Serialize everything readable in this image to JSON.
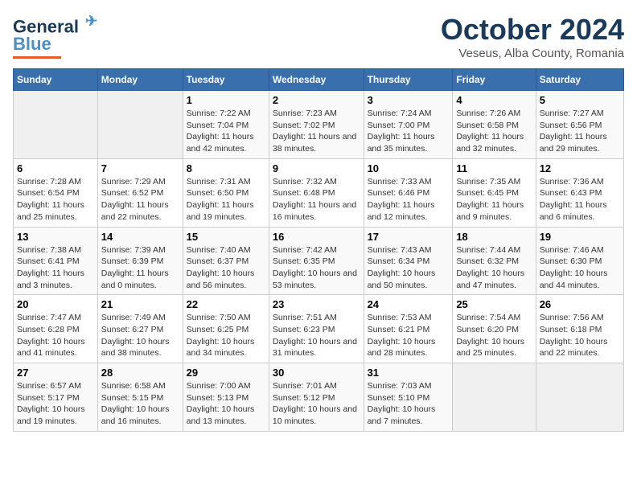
{
  "header": {
    "logo_line1": "General",
    "logo_line2": "Blue",
    "month_title": "October 2024",
    "location": "Veseus, Alba County, Romania"
  },
  "weekdays": [
    "Sunday",
    "Monday",
    "Tuesday",
    "Wednesday",
    "Thursday",
    "Friday",
    "Saturday"
  ],
  "weeks": [
    [
      {
        "day": "",
        "empty": true
      },
      {
        "day": "",
        "empty": true
      },
      {
        "day": "1",
        "sunrise": "7:22 AM",
        "sunset": "7:04 PM",
        "daylight": "11 hours and 42 minutes."
      },
      {
        "day": "2",
        "sunrise": "7:23 AM",
        "sunset": "7:02 PM",
        "daylight": "11 hours and 38 minutes."
      },
      {
        "day": "3",
        "sunrise": "7:24 AM",
        "sunset": "7:00 PM",
        "daylight": "11 hours and 35 minutes."
      },
      {
        "day": "4",
        "sunrise": "7:26 AM",
        "sunset": "6:58 PM",
        "daylight": "11 hours and 32 minutes."
      },
      {
        "day": "5",
        "sunrise": "7:27 AM",
        "sunset": "6:56 PM",
        "daylight": "11 hours and 29 minutes."
      }
    ],
    [
      {
        "day": "6",
        "sunrise": "7:28 AM",
        "sunset": "6:54 PM",
        "daylight": "11 hours and 25 minutes."
      },
      {
        "day": "7",
        "sunrise": "7:29 AM",
        "sunset": "6:52 PM",
        "daylight": "11 hours and 22 minutes."
      },
      {
        "day": "8",
        "sunrise": "7:31 AM",
        "sunset": "6:50 PM",
        "daylight": "11 hours and 19 minutes."
      },
      {
        "day": "9",
        "sunrise": "7:32 AM",
        "sunset": "6:48 PM",
        "daylight": "11 hours and 16 minutes."
      },
      {
        "day": "10",
        "sunrise": "7:33 AM",
        "sunset": "6:46 PM",
        "daylight": "11 hours and 12 minutes."
      },
      {
        "day": "11",
        "sunrise": "7:35 AM",
        "sunset": "6:45 PM",
        "daylight": "11 hours and 9 minutes."
      },
      {
        "day": "12",
        "sunrise": "7:36 AM",
        "sunset": "6:43 PM",
        "daylight": "11 hours and 6 minutes."
      }
    ],
    [
      {
        "day": "13",
        "sunrise": "7:38 AM",
        "sunset": "6:41 PM",
        "daylight": "11 hours and 3 minutes."
      },
      {
        "day": "14",
        "sunrise": "7:39 AM",
        "sunset": "6:39 PM",
        "daylight": "11 hours and 0 minutes."
      },
      {
        "day": "15",
        "sunrise": "7:40 AM",
        "sunset": "6:37 PM",
        "daylight": "10 hours and 56 minutes."
      },
      {
        "day": "16",
        "sunrise": "7:42 AM",
        "sunset": "6:35 PM",
        "daylight": "10 hours and 53 minutes."
      },
      {
        "day": "17",
        "sunrise": "7:43 AM",
        "sunset": "6:34 PM",
        "daylight": "10 hours and 50 minutes."
      },
      {
        "day": "18",
        "sunrise": "7:44 AM",
        "sunset": "6:32 PM",
        "daylight": "10 hours and 47 minutes."
      },
      {
        "day": "19",
        "sunrise": "7:46 AM",
        "sunset": "6:30 PM",
        "daylight": "10 hours and 44 minutes."
      }
    ],
    [
      {
        "day": "20",
        "sunrise": "7:47 AM",
        "sunset": "6:28 PM",
        "daylight": "10 hours and 41 minutes."
      },
      {
        "day": "21",
        "sunrise": "7:49 AM",
        "sunset": "6:27 PM",
        "daylight": "10 hours and 38 minutes."
      },
      {
        "day": "22",
        "sunrise": "7:50 AM",
        "sunset": "6:25 PM",
        "daylight": "10 hours and 34 minutes."
      },
      {
        "day": "23",
        "sunrise": "7:51 AM",
        "sunset": "6:23 PM",
        "daylight": "10 hours and 31 minutes."
      },
      {
        "day": "24",
        "sunrise": "7:53 AM",
        "sunset": "6:21 PM",
        "daylight": "10 hours and 28 minutes."
      },
      {
        "day": "25",
        "sunrise": "7:54 AM",
        "sunset": "6:20 PM",
        "daylight": "10 hours and 25 minutes."
      },
      {
        "day": "26",
        "sunrise": "7:56 AM",
        "sunset": "6:18 PM",
        "daylight": "10 hours and 22 minutes."
      }
    ],
    [
      {
        "day": "27",
        "sunrise": "6:57 AM",
        "sunset": "5:17 PM",
        "daylight": "10 hours and 19 minutes."
      },
      {
        "day": "28",
        "sunrise": "6:58 AM",
        "sunset": "5:15 PM",
        "daylight": "10 hours and 16 minutes."
      },
      {
        "day": "29",
        "sunrise": "7:00 AM",
        "sunset": "5:13 PM",
        "daylight": "10 hours and 13 minutes."
      },
      {
        "day": "30",
        "sunrise": "7:01 AM",
        "sunset": "5:12 PM",
        "daylight": "10 hours and 10 minutes."
      },
      {
        "day": "31",
        "sunrise": "7:03 AM",
        "sunset": "5:10 PM",
        "daylight": "10 hours and 7 minutes."
      },
      {
        "day": "",
        "empty": true
      },
      {
        "day": "",
        "empty": true
      }
    ]
  ]
}
